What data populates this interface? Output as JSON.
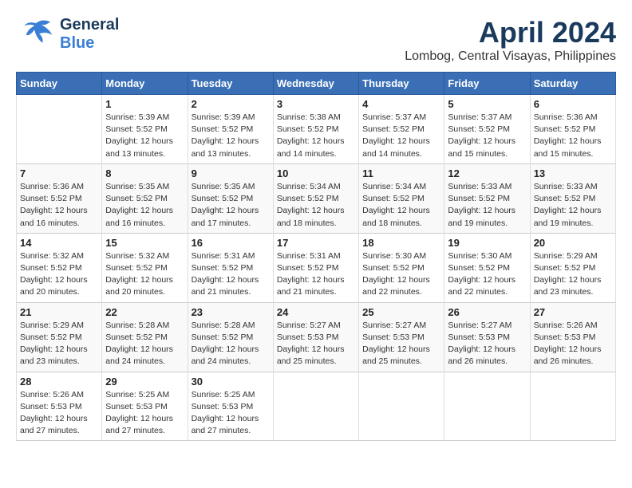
{
  "header": {
    "logo_general": "General",
    "logo_blue": "Blue",
    "month": "April 2024",
    "location": "Lombog, Central Visayas, Philippines"
  },
  "columns": [
    "Sunday",
    "Monday",
    "Tuesday",
    "Wednesday",
    "Thursday",
    "Friday",
    "Saturday"
  ],
  "weeks": [
    [
      {
        "day": "",
        "info": ""
      },
      {
        "day": "1",
        "info": "Sunrise: 5:39 AM\nSunset: 5:52 PM\nDaylight: 12 hours\nand 13 minutes."
      },
      {
        "day": "2",
        "info": "Sunrise: 5:39 AM\nSunset: 5:52 PM\nDaylight: 12 hours\nand 13 minutes."
      },
      {
        "day": "3",
        "info": "Sunrise: 5:38 AM\nSunset: 5:52 PM\nDaylight: 12 hours\nand 14 minutes."
      },
      {
        "day": "4",
        "info": "Sunrise: 5:37 AM\nSunset: 5:52 PM\nDaylight: 12 hours\nand 14 minutes."
      },
      {
        "day": "5",
        "info": "Sunrise: 5:37 AM\nSunset: 5:52 PM\nDaylight: 12 hours\nand 15 minutes."
      },
      {
        "day": "6",
        "info": "Sunrise: 5:36 AM\nSunset: 5:52 PM\nDaylight: 12 hours\nand 15 minutes."
      }
    ],
    [
      {
        "day": "7",
        "info": "Sunrise: 5:36 AM\nSunset: 5:52 PM\nDaylight: 12 hours\nand 16 minutes."
      },
      {
        "day": "8",
        "info": "Sunrise: 5:35 AM\nSunset: 5:52 PM\nDaylight: 12 hours\nand 16 minutes."
      },
      {
        "day": "9",
        "info": "Sunrise: 5:35 AM\nSunset: 5:52 PM\nDaylight: 12 hours\nand 17 minutes."
      },
      {
        "day": "10",
        "info": "Sunrise: 5:34 AM\nSunset: 5:52 PM\nDaylight: 12 hours\nand 18 minutes."
      },
      {
        "day": "11",
        "info": "Sunrise: 5:34 AM\nSunset: 5:52 PM\nDaylight: 12 hours\nand 18 minutes."
      },
      {
        "day": "12",
        "info": "Sunrise: 5:33 AM\nSunset: 5:52 PM\nDaylight: 12 hours\nand 19 minutes."
      },
      {
        "day": "13",
        "info": "Sunrise: 5:33 AM\nSunset: 5:52 PM\nDaylight: 12 hours\nand 19 minutes."
      }
    ],
    [
      {
        "day": "14",
        "info": "Sunrise: 5:32 AM\nSunset: 5:52 PM\nDaylight: 12 hours\nand 20 minutes."
      },
      {
        "day": "15",
        "info": "Sunrise: 5:32 AM\nSunset: 5:52 PM\nDaylight: 12 hours\nand 20 minutes."
      },
      {
        "day": "16",
        "info": "Sunrise: 5:31 AM\nSunset: 5:52 PM\nDaylight: 12 hours\nand 21 minutes."
      },
      {
        "day": "17",
        "info": "Sunrise: 5:31 AM\nSunset: 5:52 PM\nDaylight: 12 hours\nand 21 minutes."
      },
      {
        "day": "18",
        "info": "Sunrise: 5:30 AM\nSunset: 5:52 PM\nDaylight: 12 hours\nand 22 minutes."
      },
      {
        "day": "19",
        "info": "Sunrise: 5:30 AM\nSunset: 5:52 PM\nDaylight: 12 hours\nand 22 minutes."
      },
      {
        "day": "20",
        "info": "Sunrise: 5:29 AM\nSunset: 5:52 PM\nDaylight: 12 hours\nand 23 minutes."
      }
    ],
    [
      {
        "day": "21",
        "info": "Sunrise: 5:29 AM\nSunset: 5:52 PM\nDaylight: 12 hours\nand 23 minutes."
      },
      {
        "day": "22",
        "info": "Sunrise: 5:28 AM\nSunset: 5:52 PM\nDaylight: 12 hours\nand 24 minutes."
      },
      {
        "day": "23",
        "info": "Sunrise: 5:28 AM\nSunset: 5:52 PM\nDaylight: 12 hours\nand 24 minutes."
      },
      {
        "day": "24",
        "info": "Sunrise: 5:27 AM\nSunset: 5:53 PM\nDaylight: 12 hours\nand 25 minutes."
      },
      {
        "day": "25",
        "info": "Sunrise: 5:27 AM\nSunset: 5:53 PM\nDaylight: 12 hours\nand 25 minutes."
      },
      {
        "day": "26",
        "info": "Sunrise: 5:27 AM\nSunset: 5:53 PM\nDaylight: 12 hours\nand 26 minutes."
      },
      {
        "day": "27",
        "info": "Sunrise: 5:26 AM\nSunset: 5:53 PM\nDaylight: 12 hours\nand 26 minutes."
      }
    ],
    [
      {
        "day": "28",
        "info": "Sunrise: 5:26 AM\nSunset: 5:53 PM\nDaylight: 12 hours\nand 27 minutes."
      },
      {
        "day": "29",
        "info": "Sunrise: 5:25 AM\nSunset: 5:53 PM\nDaylight: 12 hours\nand 27 minutes."
      },
      {
        "day": "30",
        "info": "Sunrise: 5:25 AM\nSunset: 5:53 PM\nDaylight: 12 hours\nand 27 minutes."
      },
      {
        "day": "",
        "info": ""
      },
      {
        "day": "",
        "info": ""
      },
      {
        "day": "",
        "info": ""
      },
      {
        "day": "",
        "info": ""
      }
    ]
  ]
}
